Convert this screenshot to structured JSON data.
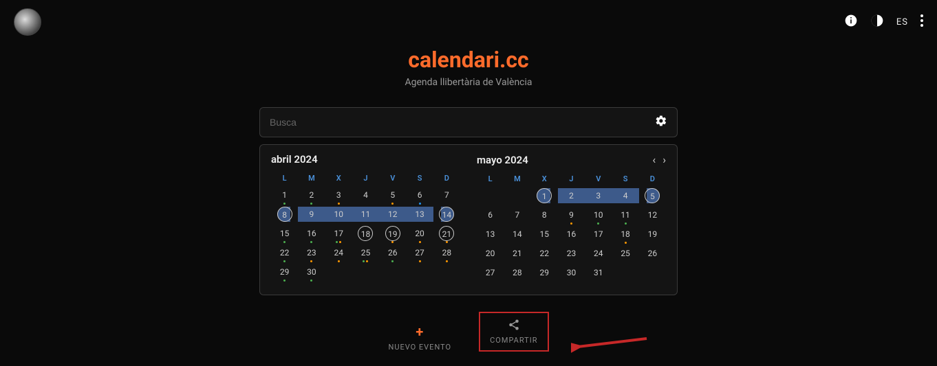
{
  "topbar": {
    "lang": "ES"
  },
  "site": {
    "title": "calendari.cc",
    "subtitle": "Agenda llibertària de València"
  },
  "search": {
    "placeholder": "Busca"
  },
  "weekdays": [
    "L",
    "M",
    "X",
    "J",
    "V",
    "S",
    "D"
  ],
  "months": [
    {
      "title": "abril 2024",
      "nav": false,
      "days": [
        {
          "n": 1,
          "dots": [
            "g"
          ]
        },
        {
          "n": 2,
          "dots": [
            "g"
          ]
        },
        {
          "n": 3,
          "dots": [
            "o"
          ]
        },
        {
          "n": 4
        },
        {
          "n": 5,
          "dots": [
            "o"
          ]
        },
        {
          "n": 6,
          "dots": [
            "b"
          ]
        },
        {
          "n": 7
        },
        {
          "n": 8,
          "circled": true,
          "range": "start"
        },
        {
          "n": 9,
          "range": "mid"
        },
        {
          "n": 10,
          "range": "mid"
        },
        {
          "n": 11,
          "range": "mid"
        },
        {
          "n": 12,
          "range": "mid"
        },
        {
          "n": 13,
          "range": "mid"
        },
        {
          "n": 14,
          "circled": true,
          "range": "end"
        },
        {
          "n": 15,
          "dots": [
            "g"
          ]
        },
        {
          "n": 16,
          "dots": [
            "g"
          ]
        },
        {
          "n": 17,
          "dots": [
            "g",
            "o"
          ]
        },
        {
          "n": 18,
          "circled": true
        },
        {
          "n": 19,
          "circled": true,
          "range": "start-end",
          "dots": [
            "o"
          ]
        },
        {
          "n": 20,
          "dots": [
            "o"
          ]
        },
        {
          "n": 21,
          "circled": true,
          "dots": [
            "o"
          ]
        },
        {
          "n": 22,
          "dots": [
            "g"
          ]
        },
        {
          "n": 23,
          "dots": [
            "o"
          ]
        },
        {
          "n": 24,
          "dots": [
            "o"
          ]
        },
        {
          "n": 25,
          "dots": [
            "g",
            "o"
          ]
        },
        {
          "n": 26,
          "dots": [
            "g"
          ]
        },
        {
          "n": 27,
          "dots": [
            "o"
          ]
        },
        {
          "n": 28,
          "dots": [
            "o"
          ]
        },
        {
          "n": 29,
          "dots": [
            "g"
          ]
        },
        {
          "n": 30,
          "dots": [
            "g"
          ]
        }
      ]
    },
    {
      "title": "mayo 2024",
      "nav": true,
      "leading_blanks": 2,
      "days": [
        {
          "n": 1,
          "circled": true,
          "range": "start"
        },
        {
          "n": 2,
          "range": "mid"
        },
        {
          "n": 3,
          "range": "mid"
        },
        {
          "n": 4,
          "range": "mid"
        },
        {
          "n": 5,
          "circled": true,
          "range": "end"
        },
        {
          "n": 6
        },
        {
          "n": 7
        },
        {
          "n": 8
        },
        {
          "n": 9,
          "dots": [
            "o"
          ]
        },
        {
          "n": 10,
          "dots": [
            "g"
          ]
        },
        {
          "n": 11,
          "dots": [
            "g"
          ]
        },
        {
          "n": 12
        },
        {
          "n": 13
        },
        {
          "n": 14
        },
        {
          "n": 15
        },
        {
          "n": 16
        },
        {
          "n": 17
        },
        {
          "n": 18,
          "dots": [
            "o"
          ]
        },
        {
          "n": 19
        },
        {
          "n": 20
        },
        {
          "n": 21
        },
        {
          "n": 22
        },
        {
          "n": 23
        },
        {
          "n": 24
        },
        {
          "n": 25
        },
        {
          "n": 26
        },
        {
          "n": 27
        },
        {
          "n": 28
        },
        {
          "n": 29
        },
        {
          "n": 30
        },
        {
          "n": 31
        }
      ]
    }
  ],
  "actions": {
    "new_event": "NUEVO EVENTO",
    "share": "COMPARTIR"
  }
}
